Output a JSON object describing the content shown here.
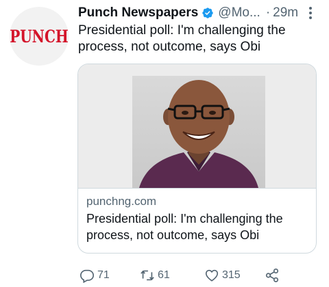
{
  "tweet": {
    "author_name": "Punch Newspapers",
    "author_handle": "@Mo...",
    "separator": "·",
    "time": "29m",
    "avatar_logo": "PUNCH",
    "text": "Presidential poll: I'm challenging the process, not outcome, says Obi",
    "verified_icon": "verified-badge-icon",
    "more_icon": "more-vertical-icon"
  },
  "card": {
    "domain": "punchng.com",
    "title": "Presidential poll: I'm challenging the process, not outcome, says Obi"
  },
  "actions": {
    "reply_count": "71",
    "retweet_count": "61",
    "like_count": "315",
    "reply_icon": "reply-icon",
    "retweet_icon": "retweet-icon",
    "like_icon": "heart-icon",
    "share_icon": "share-icon"
  },
  "colors": {
    "brand_logo": "#d4142a",
    "verified": "#1d9bf0",
    "secondary_text": "#536471",
    "border": "#cfd9de"
  }
}
